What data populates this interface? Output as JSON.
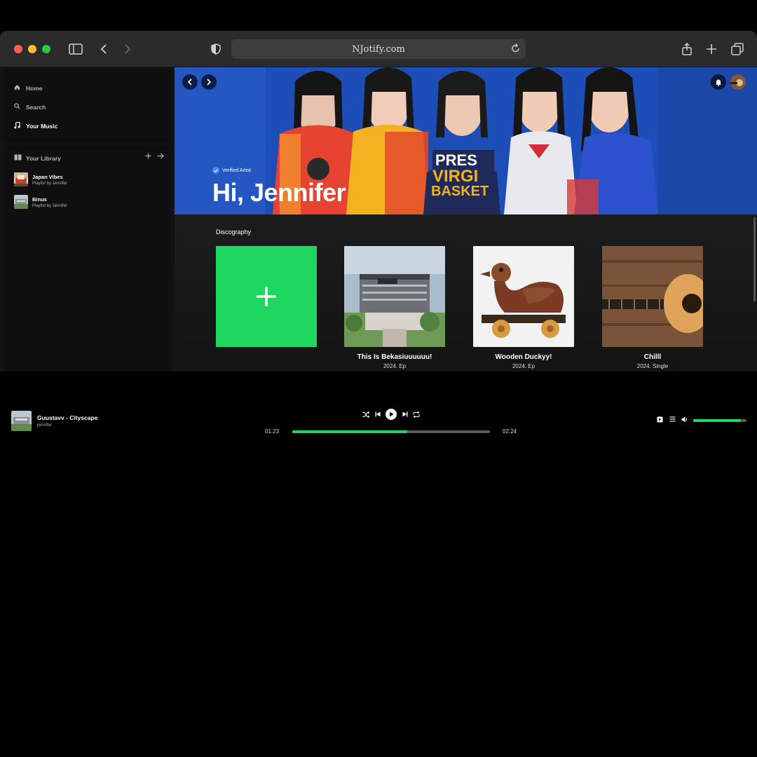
{
  "browser": {
    "url": "NJotify.com"
  },
  "sidebar": {
    "nav": [
      {
        "label": "Home",
        "icon": "home-icon"
      },
      {
        "label": "Search",
        "icon": "search-icon"
      },
      {
        "label": "Your Music",
        "icon": "music-note-icon"
      }
    ],
    "library": {
      "title": "Your Library",
      "items": [
        {
          "title": "Japan Vibes",
          "subtitle": "Playlist by Jennifer"
        },
        {
          "title": "Binus",
          "subtitle": "Playlist by Jennifer"
        }
      ]
    }
  },
  "hero": {
    "verified_label": "Verified Artist",
    "title": "Hi, Jennifer"
  },
  "discography": {
    "title": "Discography",
    "cards": [
      {
        "title": "",
        "subtitle": ""
      },
      {
        "title": "This Is Bekasiuuuuuu!",
        "subtitle": "2024. Ep"
      },
      {
        "title": "Wooden Duckyy!",
        "subtitle": "2024. Ep"
      },
      {
        "title": "Chilll",
        "subtitle": "2024. Single"
      }
    ]
  },
  "player": {
    "track": "Guustavv - Cityscape",
    "artist": "jennifer",
    "elapsed": "01:23",
    "duration": "02:24",
    "progress_fraction": 0.58,
    "volume_fraction": 0.9
  },
  "colors": {
    "accent": "#1ed760",
    "hero_blue": "#1f4fb8"
  }
}
